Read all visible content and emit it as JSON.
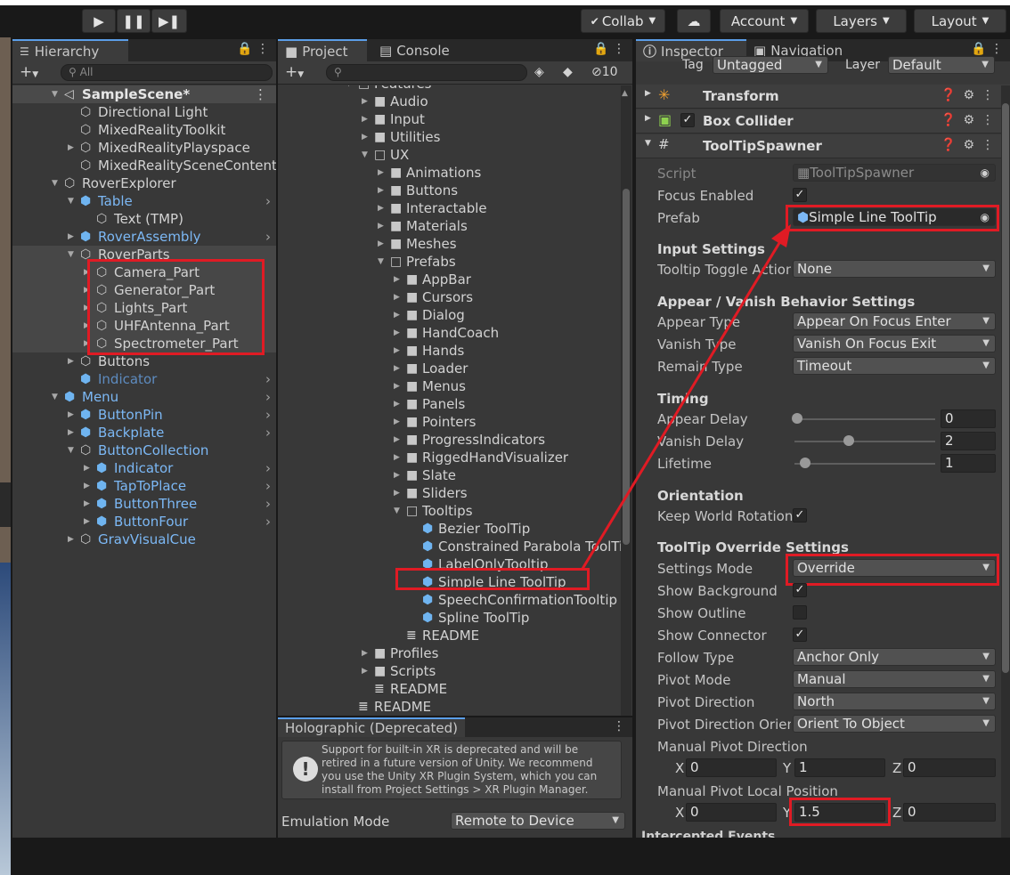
{
  "toolbar": {
    "play_icon": "play-icon",
    "pause_icon": "pause-icon",
    "step_icon": "step-icon",
    "collab": "Collab",
    "account": "Account",
    "layers": "Layers",
    "layout": "Layout"
  },
  "hierarchy": {
    "tab": "Hierarchy",
    "search_placeholder": "All",
    "scene": "SampleScene*",
    "items": [
      {
        "label": "Directional Light"
      },
      {
        "label": "MixedRealityToolkit"
      },
      {
        "label": "MixedRealityPlayspace"
      },
      {
        "label": "MixedRealitySceneContent"
      },
      {
        "label": "RoverExplorer"
      },
      {
        "label": "Table"
      },
      {
        "label": "Text (TMP)"
      },
      {
        "label": "RoverAssembly"
      },
      {
        "label": "RoverParts"
      },
      {
        "label": "Camera_Part"
      },
      {
        "label": "Generator_Part"
      },
      {
        "label": "Lights_Part"
      },
      {
        "label": "UHFAntenna_Part"
      },
      {
        "label": "Spectrometer_Part"
      },
      {
        "label": "Buttons"
      },
      {
        "label": "Indicator"
      },
      {
        "label": "Menu"
      },
      {
        "label": "ButtonPin"
      },
      {
        "label": "Backplate"
      },
      {
        "label": "ButtonCollection"
      },
      {
        "label": "Indicator"
      },
      {
        "label": "TapToPlace"
      },
      {
        "label": "ButtonThree"
      },
      {
        "label": "ButtonFour"
      },
      {
        "label": "GravVisualCue"
      }
    ]
  },
  "project": {
    "tab_project": "Project",
    "tab_console": "Console",
    "hidden_count": "10",
    "items": [
      {
        "label": "Features"
      },
      {
        "label": "Audio"
      },
      {
        "label": "Input"
      },
      {
        "label": "Utilities"
      },
      {
        "label": "UX"
      },
      {
        "label": "Animations"
      },
      {
        "label": "Buttons"
      },
      {
        "label": "Interactable"
      },
      {
        "label": "Materials"
      },
      {
        "label": "Meshes"
      },
      {
        "label": "Prefabs"
      },
      {
        "label": "AppBar"
      },
      {
        "label": "Cursors"
      },
      {
        "label": "Dialog"
      },
      {
        "label": "HandCoach"
      },
      {
        "label": "Hands"
      },
      {
        "label": "Loader"
      },
      {
        "label": "Menus"
      },
      {
        "label": "Panels"
      },
      {
        "label": "Pointers"
      },
      {
        "label": "ProgressIndicators"
      },
      {
        "label": "RiggedHandVisualizer"
      },
      {
        "label": "Slate"
      },
      {
        "label": "Sliders"
      },
      {
        "label": "Tooltips"
      },
      {
        "label": "Bezier ToolTip"
      },
      {
        "label": "Constrained Parabola ToolTip"
      },
      {
        "label": "LabelOnlyTooltip"
      },
      {
        "label": "Simple Line ToolTip"
      },
      {
        "label": "SpeechConfirmationTooltip"
      },
      {
        "label": "Spline ToolTip"
      },
      {
        "label": "README"
      },
      {
        "label": "Profiles"
      },
      {
        "label": "Scripts"
      },
      {
        "label": "README"
      },
      {
        "label": "README"
      }
    ]
  },
  "holographic": {
    "title": "Holographic (Deprecated)",
    "warning": "Support for built-in XR is deprecated and will be retired in a future version of Unity. We recommend you use the Unity XR Plugin System, which you can install from Project Settings > XR Plugin Manager.",
    "emulation_label": "Emulation Mode",
    "emulation_value": "Remote to Device"
  },
  "inspector": {
    "tab_inspector": "Inspector",
    "tab_navigation": "Navigation",
    "tag_label": "Tag",
    "tag_value": "Untagged",
    "layer_label": "Layer",
    "layer_value": "Default",
    "components": {
      "transform": "Transform",
      "box_collider": "Box Collider",
      "spawner": "ToolTipSpawner"
    },
    "script_label": "Script",
    "script_value": "ToolTipSpawner",
    "focus_enabled": "Focus Enabled",
    "prefab_label": "Prefab",
    "prefab_value": "Simple Line ToolTip",
    "input_settings": "Input Settings",
    "toggle_label": "Tooltip Toggle Action",
    "toggle_value": "None",
    "appear_header": "Appear / Vanish Behavior Settings",
    "appear_type": "Appear Type",
    "appear_value": "Appear On Focus Enter",
    "vanish_type": "Vanish Type",
    "vanish_value": "Vanish On Focus Exit",
    "remain_type": "Remain Type",
    "remain_value": "Timeout",
    "timing": "Timing",
    "appear_delay": "Appear Delay",
    "appear_delay_value": "0",
    "vanish_delay": "Vanish Delay",
    "vanish_delay_value": "2",
    "lifetime": "Lifetime",
    "lifetime_value": "1",
    "orientation": "Orientation",
    "keep_world": "Keep World Rotation",
    "override_header": "ToolTip Override Settings",
    "settings_mode": "Settings Mode",
    "settings_mode_value": "Override",
    "show_background": "Show Background",
    "show_outline": "Show Outline",
    "show_connector": "Show Connector",
    "follow_type": "Follow Type",
    "follow_value": "Anchor Only",
    "pivot_mode": "Pivot Mode",
    "pivot_mode_value": "Manual",
    "pivot_direction": "Pivot Direction",
    "pivot_direction_value": "North",
    "pivot_orient": "Pivot Direction Orient",
    "pivot_orient_value": "Orient To Object",
    "manual_pivot_dir": "Manual Pivot Direction",
    "mpd": {
      "x": "0",
      "y": "1",
      "z": "0"
    },
    "manual_pivot_local": "Manual Pivot Local Position",
    "mpl": {
      "x": "0",
      "y": "1.5",
      "z": "0"
    },
    "intercepted": "Intercepted Events",
    "xyz": {
      "x": "X",
      "y": "Y",
      "z": "Z"
    }
  }
}
